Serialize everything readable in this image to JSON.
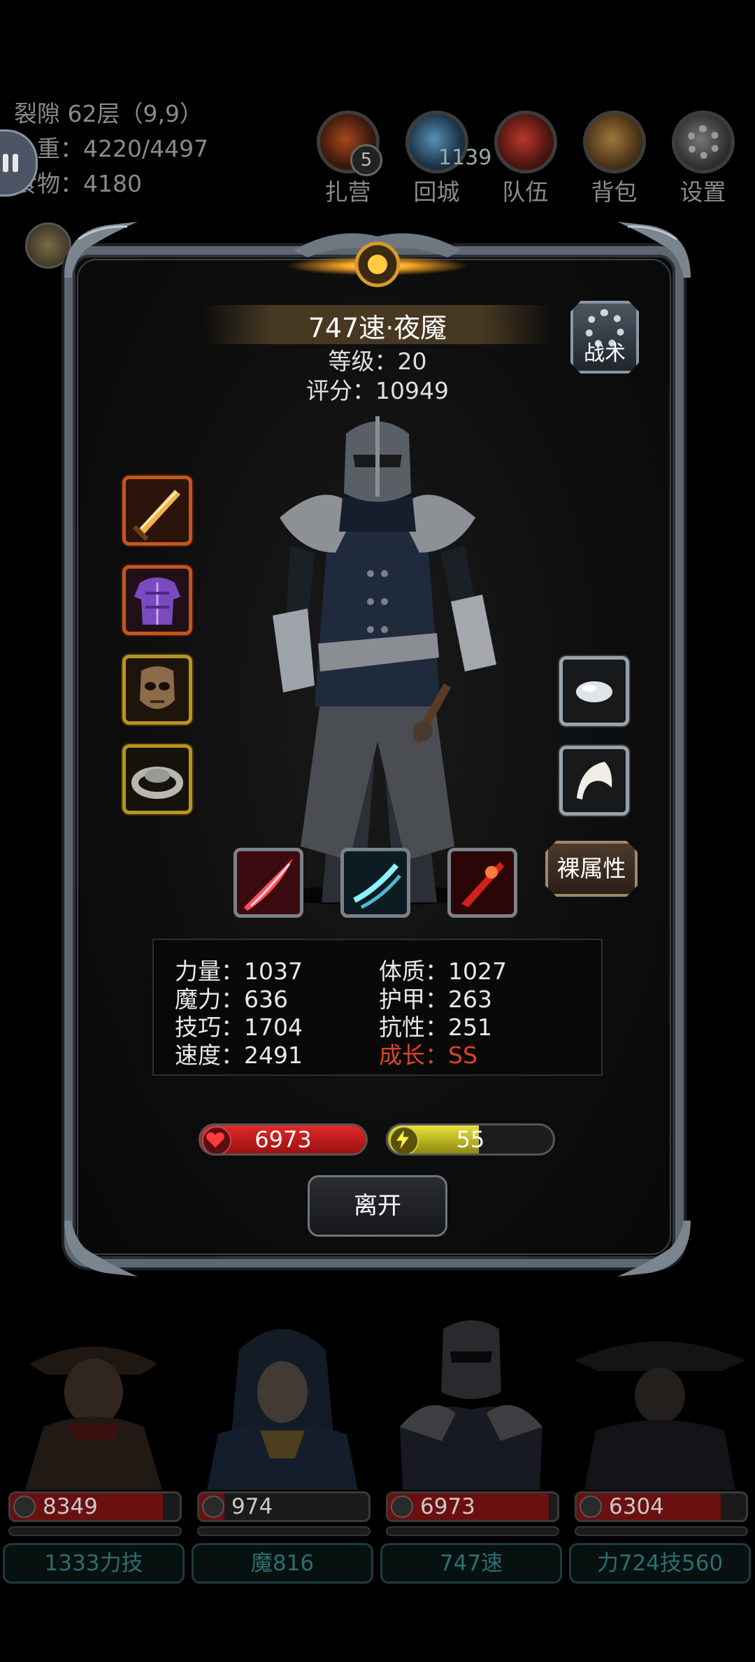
{
  "hud": {
    "floor": "裂隙 62层（9,9）",
    "weight": "负重：4220/4497",
    "food": "食物：4180",
    "nav": [
      {
        "label": "扎营",
        "icon": "campfire-icon",
        "badge": "5"
      },
      {
        "label": "回城",
        "icon": "portal-icon",
        "count": "1139"
      },
      {
        "label": "队伍",
        "icon": "team-icon"
      },
      {
        "label": "背包",
        "icon": "backpack-icon"
      },
      {
        "label": "设置",
        "icon": "gear-icon"
      }
    ]
  },
  "hero": {
    "name": "747速·夜魇",
    "level": "等级：20",
    "score": "评分：10949",
    "tactics_label": "战术",
    "naked_attr_label": "裸属性",
    "leave_label": "离开",
    "hp": "6973",
    "energy": "55",
    "hp_fraction": 1.0,
    "energy_fraction": 0.55,
    "equipment": [
      {
        "slot": "weapon",
        "icon": "flaming-sword-icon",
        "rarity": "orange"
      },
      {
        "slot": "armor",
        "icon": "purple-chest-armor-icon",
        "rarity": "orange"
      },
      {
        "slot": "head",
        "icon": "skull-mask-icon",
        "rarity": "gold"
      },
      {
        "slot": "ring",
        "icon": "silver-ring-icon",
        "rarity": "gold"
      },
      {
        "slot": "trinket",
        "icon": "white-stone-icon",
        "rarity": "gray"
      },
      {
        "slot": "trinket2",
        "icon": "white-feather-icon",
        "rarity": "gray"
      }
    ],
    "skills": [
      {
        "icon": "red-slash-skill-icon"
      },
      {
        "icon": "cyan-claw-skill-icon"
      },
      {
        "icon": "blood-blade-skill-icon"
      }
    ],
    "stats": [
      {
        "text": "力量：1037"
      },
      {
        "text": "体质：1027"
      },
      {
        "text": "魔力：636"
      },
      {
        "text": "护甲：263"
      },
      {
        "text": "技巧：1704"
      },
      {
        "text": "抗性：251"
      },
      {
        "text": "速度：2491"
      },
      {
        "text": "成长：SS",
        "color": "#e0402a"
      }
    ]
  },
  "team": [
    {
      "hp": "8349",
      "tag": "1333力技",
      "hp_fraction": 0.9
    },
    {
      "hp": "974",
      "tag": "魔816",
      "hp_fraction": 0.15
    },
    {
      "hp": "6973",
      "tag": "747速",
      "hp_fraction": 0.95
    },
    {
      "hp": "6304",
      "tag": "力724技560",
      "hp_fraction": 0.85
    }
  ]
}
